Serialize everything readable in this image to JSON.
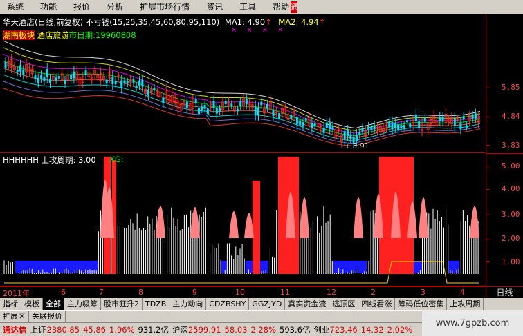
{
  "menu": {
    "items": [
      "系统",
      "功能",
      "报价",
      "分析",
      "扩展市场行情",
      "资讯",
      "工具",
      "帮助"
    ],
    "corner": "通"
  },
  "price_panel": {
    "title": "华天酒店(日线,前复权)",
    "indicator_name": "不亏钱(15,25,35,45,60,80,95,110)",
    "ma1_label": "MA1: 4.90",
    "ma1_arrow": "↑",
    "ma2_label": "MA2: 4.94",
    "ma2_arrow": "↑",
    "ma_marks": [
      "×",
      "×",
      "×",
      "×"
    ],
    "info_prefix": "湖南板块",
    "info_sector": "酒店旅游",
    "info_listing": "市日期:19960808",
    "low_marker": "←3.91",
    "colors": {
      "up": "#ff3030",
      "down": "#00e0ff",
      "text": "#ffffff"
    }
  },
  "indicator_panel": {
    "name": "HHHHHH",
    "label": "上攻周期: 3.00",
    "xg_label": "XG:",
    "colors": {
      "bar": "#ffffff",
      "strong": "#ff2020",
      "pink": "#ff8080",
      "blue": "#1a1aff",
      "line": "#ffd000"
    }
  },
  "axis": {
    "price_ticks": [
      "5.85",
      "4.84",
      "3.83"
    ],
    "ind_ticks": [
      "5.00",
      "4.00",
      "3.00",
      "2.00",
      "1.00"
    ]
  },
  "dates": [
    "2011年",
    "6",
    "7",
    "8",
    "9",
    "10",
    "11",
    "12",
    "2",
    "3",
    "4"
  ],
  "period": "日线",
  "tabs": [
    "指标",
    "模板",
    "全部",
    "主力吸筹",
    "股市狂升2",
    "TDZB",
    "主力动向",
    "CDZBSHY",
    "GGZJYD",
    "真实资金流",
    "逃顶区",
    "四线看涨",
    "筹码低位密集",
    "上攻周期"
  ],
  "tabs2": [
    "扩展区",
    "关联报价"
  ],
  "status": {
    "brand": "通达信",
    "sh_label": "上证",
    "sh_value": "2380.85",
    "sh_change": "45.86",
    "sh_pct": "1.96%",
    "sh_amount": "931.2亿",
    "sz_label": "沪深",
    "sz_value": "2599.91",
    "sz_change": "58.03",
    "sz_pct": "2.28%",
    "sz_amount": "593.6亿",
    "cy_label": "创业",
    "cy_value": "723.46",
    "cy_change": "14.32",
    "cy_pct": "2.02%"
  },
  "watermark": "www.7gpzb.com",
  "chart_data": {
    "type": "candlestick",
    "price_axis": [
      3.83,
      4.84,
      5.85
    ],
    "indicator_axis": [
      1.0,
      2.0,
      3.0,
      4.0,
      5.0
    ],
    "ma1": 4.9,
    "ma2": 4.94,
    "low": 3.91,
    "indicator_value": 3.0
  }
}
